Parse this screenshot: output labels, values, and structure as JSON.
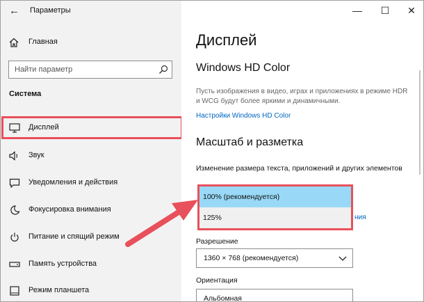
{
  "titlebar": {
    "title": "Параметры",
    "back_icon": "back-arrow-icon",
    "controls": [
      "minimize-icon",
      "maximize-icon",
      "close-icon"
    ]
  },
  "sidebar": {
    "home_label": "Главная",
    "search_placeholder": "Найти параметр",
    "section": "Система",
    "items": [
      {
        "label": "Дисплей",
        "icon": "monitor-icon",
        "active": true
      },
      {
        "label": "Звук",
        "icon": "speaker-icon"
      },
      {
        "label": "Уведомления и действия",
        "icon": "notification-icon"
      },
      {
        "label": "Фокусировка внимания",
        "icon": "moon-icon"
      },
      {
        "label": "Питание и спящий режим",
        "icon": "power-icon"
      },
      {
        "label": "Память устройства",
        "icon": "storage-icon"
      },
      {
        "label": "Режим планшета",
        "icon": "tablet-icon"
      }
    ]
  },
  "main": {
    "title": "Дисплей",
    "hdr_heading": "Windows HD Color",
    "hdr_desc": "Пусть изображения в видео, играх и приложениях в режиме HDR и WCG будут более яркими и динамичными.",
    "hdr_link": "Настройки Windows HD Color",
    "scale_heading": "Масштаб и разметка",
    "scale_label": "Изменение размера текста, приложений и других элементов",
    "scale_options": [
      {
        "label": "100% (рекомендуется)",
        "selected": true
      },
      {
        "label": "125%",
        "selected": false
      }
    ],
    "partial_link": "ния",
    "resolution_label": "Разрешение",
    "resolution_value": "1360 × 768 (рекомендуется)",
    "orientation_label": "Ориентация",
    "orientation_value": "Альбомная"
  },
  "colors": {
    "accent": "#0067c0",
    "highlight": "#e8505b",
    "selected_option": "#99d9f7",
    "sidebar_bg": "#f2f2f2"
  }
}
